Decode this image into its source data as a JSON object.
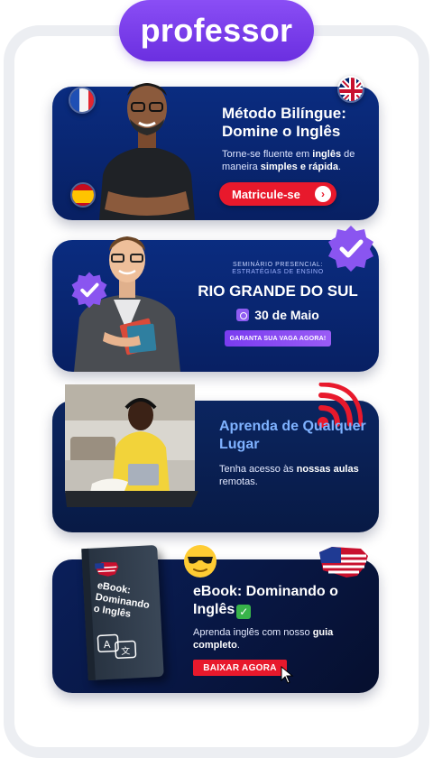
{
  "brand": {
    "label": "professor"
  },
  "card1": {
    "title": "Método Bilíngue: Domine o Inglês",
    "desc_pre": "Torne-se fluente em ",
    "desc_b1": "inglês",
    "desc_mid": " de maneira ",
    "desc_b2": "simples e rápida",
    "desc_end": ".",
    "button": "Matricule-se",
    "button_icon": "chevron-right-icon"
  },
  "card2": {
    "kicker1": "SEMINÁRIO PRESENCIAL:",
    "kicker2": "ESTRATÉGIAS DE ENSINO",
    "title": "RIO GRANDE DO SUL",
    "date": "30 de Maio",
    "button": "GARANTA SUA VAGA AGORA!"
  },
  "card3": {
    "title": "Aprenda de Qualquer Lugar",
    "desc_pre": "Tenha acesso às ",
    "desc_b": "nossas aulas",
    "desc_end": " remotas."
  },
  "card4": {
    "title": "eBook: Dominando o Inglês",
    "desc_pre": "Aprenda inglês com nosso ",
    "desc_b": "guia completo",
    "desc_end": ".",
    "button": "BAIXAR AGORA",
    "book_title": "eBook: Dominando o Inglês"
  },
  "colors": {
    "brand_purple": "#7a3cf0",
    "card_navy": "#0a2c80",
    "cta_red": "#e8192c",
    "accent_blue": "#7fb2ff"
  }
}
